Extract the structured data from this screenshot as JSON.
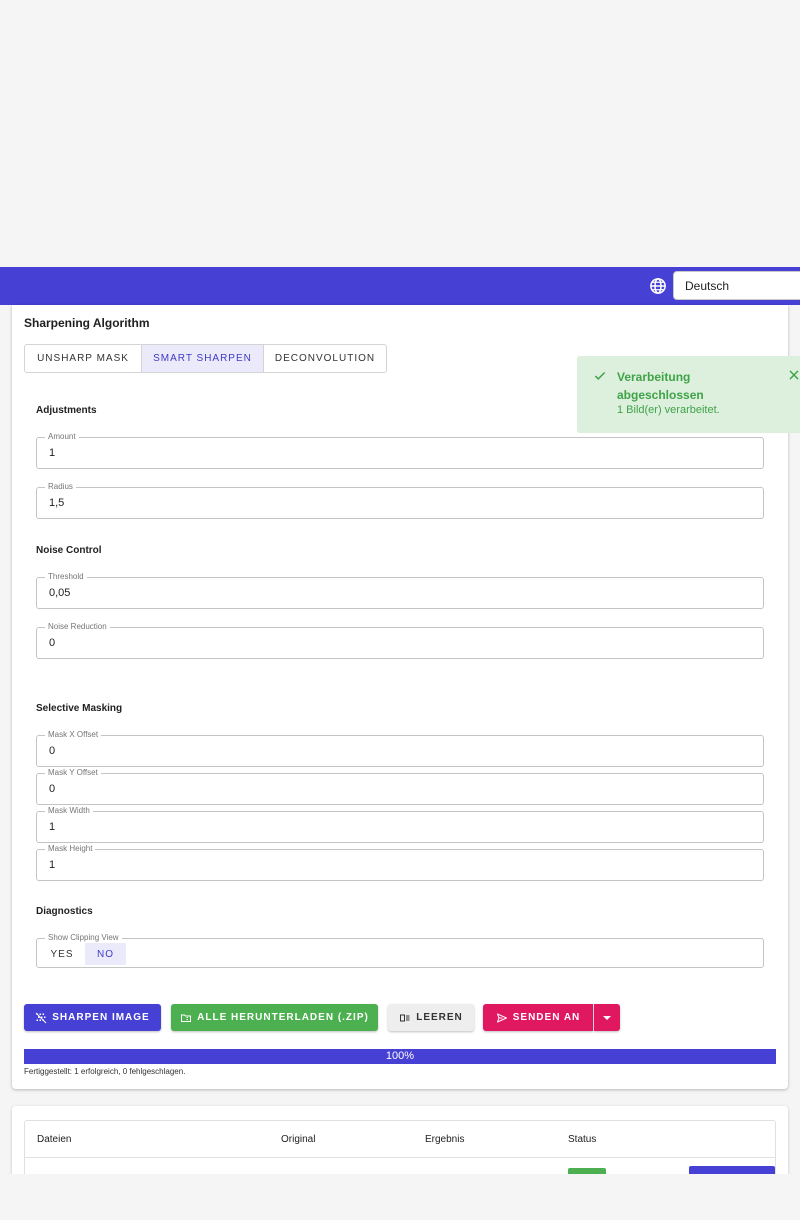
{
  "header": {
    "language": "Deutsch",
    "accent": "#4640d4"
  },
  "sharpening": {
    "title": "Sharpening Algorithm",
    "algorithms": [
      {
        "label": "UNSHARP MASK",
        "active": false
      },
      {
        "label": "SMART SHARPEN",
        "active": true
      },
      {
        "label": "DECONVOLUTION",
        "active": false
      }
    ]
  },
  "adjustments": {
    "title": "Adjustments",
    "amount": {
      "label": "Amount",
      "value": "1"
    },
    "radius": {
      "label": "Radius",
      "value": "1,5"
    }
  },
  "noise_control": {
    "title": "Noise Control",
    "threshold": {
      "label": "Threshold",
      "value": "0,05"
    },
    "noise_reduction": {
      "label": "Noise Reduction",
      "value": "0"
    }
  },
  "selective_masking": {
    "title": "Selective Masking",
    "mask_x": {
      "label": "Mask X Offset",
      "value": "0"
    },
    "mask_y": {
      "label": "Mask Y Offset",
      "value": "0"
    },
    "mask_width": {
      "label": "Mask Width",
      "value": "1"
    },
    "mask_height": {
      "label": "Mask Height",
      "value": "1"
    }
  },
  "diagnostics": {
    "title": "Diagnostics",
    "clipping": {
      "label": "Show Clipping View",
      "yes": "YES",
      "no": "NO",
      "selected": "NO"
    }
  },
  "actions": {
    "sharpen": "SHARPEN IMAGE",
    "download": "ALLE HERUNTERLADEN (.ZIP)",
    "clear": "LEEREN",
    "send": "SENDEN AN",
    "colors": {
      "sharpen": "#4640d4",
      "download": "#4caf50",
      "clear": "#eeeeee",
      "send": "#e0185f"
    }
  },
  "progress": {
    "value": 100,
    "label": "100%",
    "note": "Fertiggestellt: 1 erfolgreich, 0 fehlgeschlagen."
  },
  "results_table": {
    "headers": [
      "Dateien",
      "Original",
      "Ergebnis",
      "Status"
    ]
  },
  "toast": {
    "title": "Verarbeitung abgeschlossen",
    "message": "1 Bild(er) verarbeitet.",
    "color": "#3fa348"
  }
}
